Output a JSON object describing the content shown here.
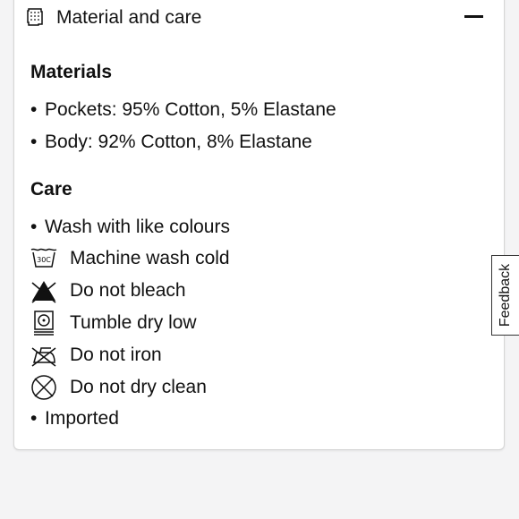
{
  "accordion": {
    "title": "Material and care",
    "header_icon": "fabric-swatch-icon",
    "toggle_icon": "minus-icon"
  },
  "materials": {
    "heading": "Materials",
    "items": [
      "Pockets: 95% Cotton, 5% Elastane",
      "Body: 92% Cotton, 8% Elastane"
    ]
  },
  "care": {
    "heading": "Care",
    "bullet_top": "Wash with like colours",
    "symbols": [
      {
        "icon": "wash-30c-icon",
        "label": "Machine wash cold",
        "icon_text": "30C"
      },
      {
        "icon": "do-not-bleach-icon",
        "label": "Do not bleach"
      },
      {
        "icon": "tumble-dry-low-icon",
        "label": "Tumble dry low"
      },
      {
        "icon": "do-not-iron-icon",
        "label": "Do not iron"
      },
      {
        "icon": "do-not-dry-clean-icon",
        "label": "Do not dry clean"
      }
    ],
    "bullet_bottom": "Imported"
  },
  "feedback": {
    "label": "Feedback"
  },
  "bullet_char": "•"
}
